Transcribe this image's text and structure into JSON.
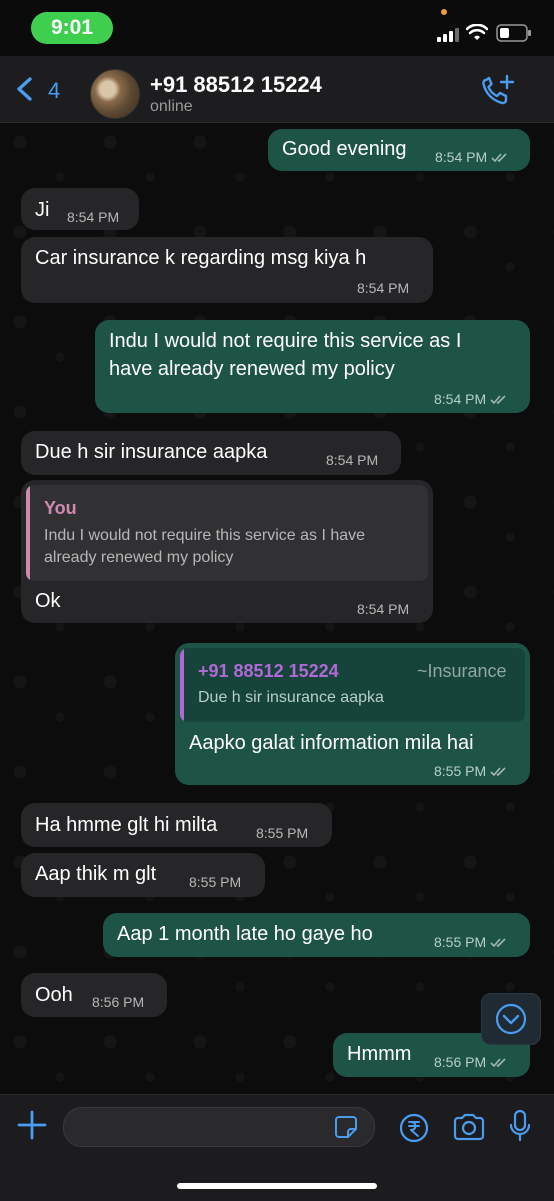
{
  "status_bar": {
    "time": "9:01"
  },
  "header": {
    "back_count": "4",
    "contact_name": "+91 88512 15224",
    "contact_status": "online"
  },
  "messages": [
    {
      "dir": "out",
      "text": "Good evening",
      "time": "8:54 PM"
    },
    {
      "dir": "in",
      "text": "Ji",
      "time": "8:54 PM"
    },
    {
      "dir": "in",
      "text": "Car insurance k regarding msg kiya h",
      "time": "8:54 PM"
    },
    {
      "dir": "out",
      "text_line1": "Indu I would not require this service as I",
      "text_line2": "have already renewed my policy",
      "time": "8:54 PM"
    },
    {
      "dir": "in",
      "text": "Due h sir insurance aapka",
      "time": "8:54 PM"
    },
    {
      "dir": "in",
      "quote_author": "You",
      "quote_line1": "Indu I would not require this service as I have",
      "quote_line2": "already renewed my policy",
      "text": "Ok",
      "time": "8:54 PM"
    },
    {
      "dir": "out",
      "quote_author": "+91 88512 15224",
      "quote_tag": "~Insurance",
      "quote_text": "Due h sir insurance aapka",
      "text": "Aapko galat information mila hai",
      "time": "8:55 PM"
    },
    {
      "dir": "in",
      "text": "Ha hmme glt hi milta",
      "time": "8:55 PM"
    },
    {
      "dir": "in",
      "text": "Aap thik m glt",
      "time": "8:55 PM"
    },
    {
      "dir": "out",
      "text": "Aap 1 month late ho gaye ho",
      "time": "8:55 PM"
    },
    {
      "dir": "in",
      "text": "Ooh",
      "time": "8:56 PM"
    },
    {
      "dir": "out",
      "text": "Hmmm",
      "time": "8:56 PM"
    }
  ],
  "colors": {
    "accent": "#4a9cf0",
    "outgoing_bubble": "#1d5446",
    "incoming_bubble": "#262628",
    "quote_you": "#d08ab0",
    "quote_contact": "#b06ad8",
    "status_pill": "#3ecf4f"
  },
  "icons": [
    "back-chevron-icon",
    "call-add-icon",
    "plus-icon",
    "sticker-icon",
    "rupee-icon",
    "camera-icon",
    "microphone-icon",
    "scroll-down-icon",
    "read-ticks-icon"
  ]
}
